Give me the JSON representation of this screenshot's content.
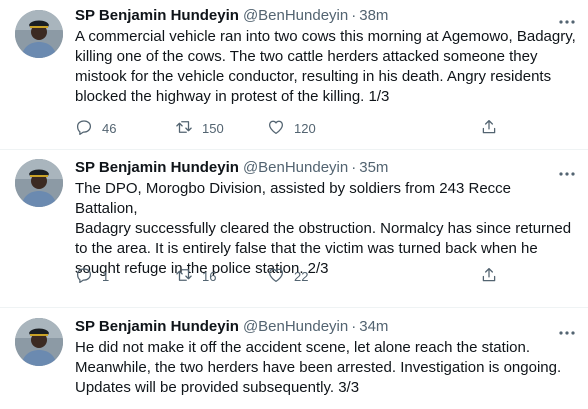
{
  "tweets": [
    {
      "name": "SP Benjamin Hundeyin",
      "handle": "@BenHundeyin",
      "time": "38m",
      "text": "A commercial vehicle ran into two cows this morning at Agemowo, Badagry,\nkilling one of the cows. The two cattle herders attacked someone they\nmistook for the vehicle conductor, resulting in his death. Angry residents\nblocked the highway in protest of the killing. 1/3",
      "replies": "46",
      "retweets": "150",
      "likes": "120"
    },
    {
      "name": "SP Benjamin Hundeyin",
      "handle": "@BenHundeyin",
      "time": "35m",
      "text": "The DPO, Morogbo Division, assisted by soldiers from 243 Recce Battalion,\nBadagry successfully cleared the obstruction. Normalcy has since returned\nto the area. It is entirely false that the victim was turned back when he\nsought refuge in the police station. 2/3",
      "replies": "1",
      "retweets": "16",
      "likes": "22"
    },
    {
      "name": "SP Benjamin Hundeyin",
      "handle": "@BenHundeyin",
      "time": "34m",
      "text": "He did not make it off the accident scene, let alone reach the station.\nMeanwhile, the two herders have been arrested. Investigation is ongoing.\nUpdates will be provided subsequently. 3/3"
    }
  ],
  "separator": "·",
  "icons": {
    "more": "more-icon",
    "reply": "reply-icon",
    "retweet": "retweet-icon",
    "like": "like-icon",
    "share": "share-icon"
  },
  "colors": {
    "text": "#0f1419",
    "secondary": "#536471",
    "divider": "#eff3f4"
  }
}
